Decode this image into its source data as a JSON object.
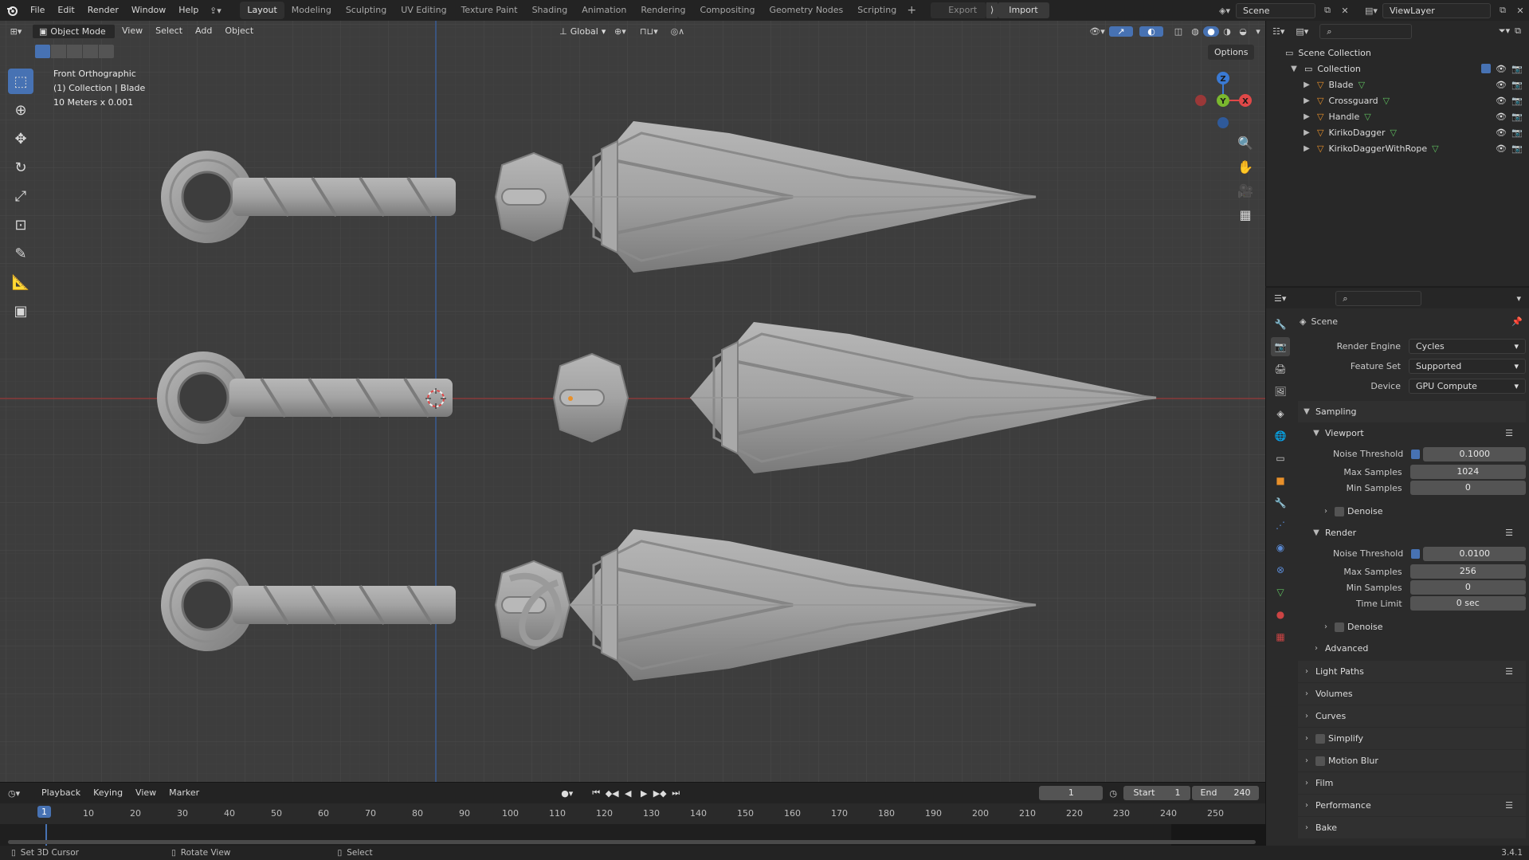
{
  "topbar": {
    "menus": [
      "File",
      "Edit",
      "Render",
      "Window",
      "Help"
    ],
    "workspaces": [
      "Layout",
      "Modeling",
      "Sculpting",
      "UV Editing",
      "Texture Paint",
      "Shading",
      "Animation",
      "Rendering",
      "Compositing",
      "Geometry Nodes",
      "Scripting"
    ],
    "active_workspace": "Layout",
    "export_label": "Export",
    "import_label": "Import",
    "scene_name": "Scene",
    "viewlayer_name": "ViewLayer"
  },
  "viewport": {
    "mode_label": "Object Mode",
    "menus": [
      "View",
      "Select",
      "Add",
      "Object"
    ],
    "orientation": "Global",
    "options_label": "Options",
    "overlay_lines": [
      "Front Orthographic",
      "(1) Collection | Blade",
      "10 Meters x 0.001"
    ],
    "gizmo_axes": {
      "x": "X",
      "y": "Y",
      "z": "Z"
    },
    "colors": {
      "bg": "#3d3d3d",
      "grid": "#464646",
      "x_axis": "#8a3a3a",
      "z_axis": "#3a5c94",
      "model": "#9b9b9b"
    }
  },
  "outliner": {
    "root": "Scene Collection",
    "collection": "Collection",
    "objects": [
      "Blade",
      "Crossguard",
      "Handle",
      "KirikoDagger",
      "KirikoDaggerWithRope"
    ]
  },
  "properties": {
    "context": "Scene",
    "render_engine_label": "Render Engine",
    "render_engine": "Cycles",
    "feature_set_label": "Feature Set",
    "feature_set": "Supported",
    "device_label": "Device",
    "device": "GPU Compute",
    "sampling_label": "Sampling",
    "viewport_label": "Viewport",
    "render_label": "Render",
    "noise_threshold_label": "Noise Threshold",
    "max_samples_label": "Max Samples",
    "min_samples_label": "Min Samples",
    "time_limit_label": "Time Limit",
    "denoise_label": "Denoise",
    "advanced_label": "Advanced",
    "viewport_noise": "0.1000",
    "viewport_max": "1024",
    "viewport_min": "0",
    "render_noise": "0.0100",
    "render_max": "256",
    "render_min": "0",
    "render_time_limit": "0 sec",
    "panels": [
      "Light Paths",
      "Volumes",
      "Curves",
      "Simplify",
      "Motion Blur",
      "Film",
      "Performance",
      "Bake"
    ]
  },
  "timeline": {
    "menus": [
      "Playback",
      "Keying",
      "View",
      "Marker"
    ],
    "current_frame": "1",
    "start_label": "Start",
    "start": "1",
    "end_label": "End",
    "end": "240",
    "ticks": [
      "1",
      "10",
      "20",
      "30",
      "40",
      "50",
      "60",
      "70",
      "80",
      "90",
      "100",
      "110",
      "120",
      "130",
      "140",
      "150",
      "160",
      "170",
      "180",
      "190",
      "200",
      "210",
      "220",
      "230",
      "240",
      "250"
    ]
  },
  "statusbar": {
    "hints": [
      "Set 3D Cursor",
      "Rotate View",
      "Select"
    ],
    "version": "3.4.1"
  }
}
